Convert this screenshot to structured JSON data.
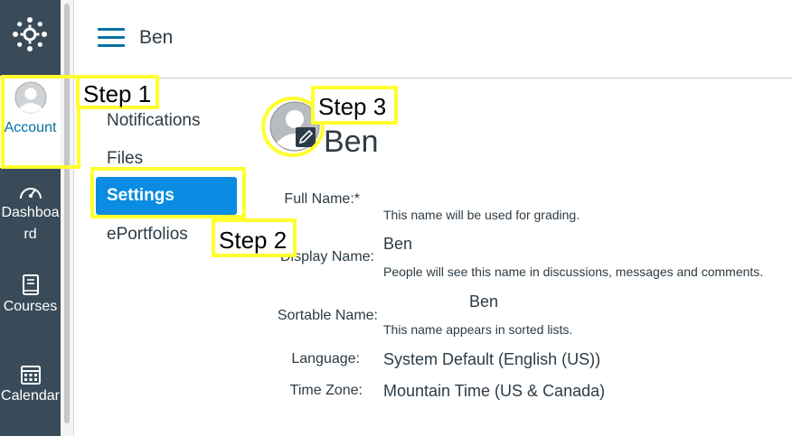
{
  "global_nav": {
    "items": [
      {
        "label": "Account",
        "icon": "user-icon",
        "active": true
      },
      {
        "label": "Dashboard",
        "icon": "speedometer-icon"
      },
      {
        "label": "Courses",
        "icon": "book-icon"
      },
      {
        "label": "Calendar",
        "icon": "calendar-icon"
      }
    ]
  },
  "header": {
    "breadcrumb": "Ben",
    "menu_icon": "hamburger-icon"
  },
  "account_nav": {
    "items": [
      "Notifications",
      "Files",
      "Settings",
      "ePortfolios"
    ],
    "active": "Settings"
  },
  "callouts": {
    "step1": "Step 1",
    "step2": "Step 2",
    "step3": "Step 3"
  },
  "profile": {
    "name": "Ben",
    "avatar_edit_icon": "pencil-icon",
    "fields": {
      "full_name": {
        "label": "Full Name:*",
        "hint": "This name will be used for grading."
      },
      "display_name": {
        "label": "Display Name:",
        "value": "Ben",
        "hint": "People will see this name in discussions, messages and comments."
      },
      "sortable_name": {
        "label": "Sortable Name:",
        "value": "Ben",
        "hint": "This name appears in sorted lists."
      },
      "language": {
        "label": "Language:",
        "value": "System Default (English (US))"
      },
      "time_zone": {
        "label": "Time Zone:",
        "value": "Mountain Time (US & Canada)"
      }
    }
  },
  "colors": {
    "nav_bg": "#394b58",
    "brand_blue": "#0770a3",
    "active_pill": "#0a8ce2",
    "callout_yellow": "#ffff2e"
  }
}
